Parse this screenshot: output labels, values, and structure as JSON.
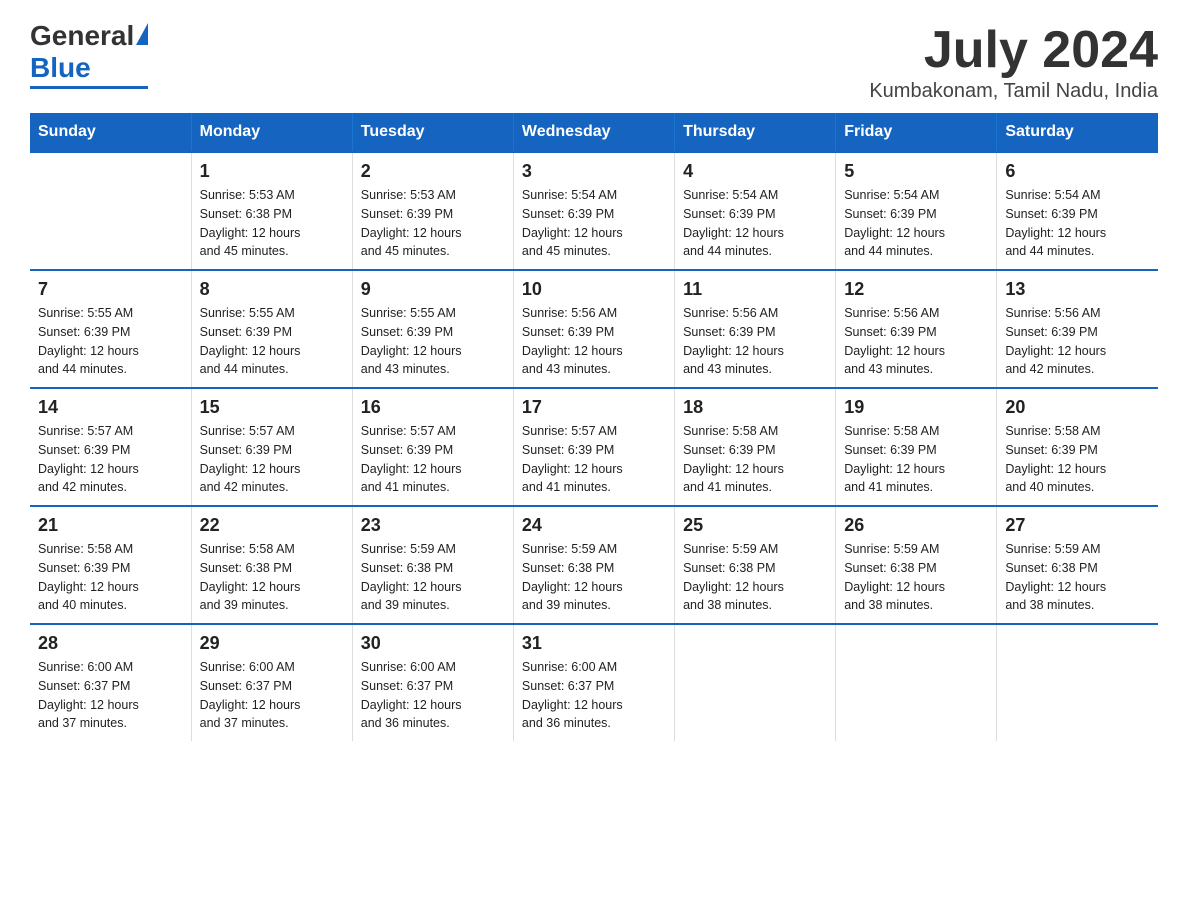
{
  "logo": {
    "general": "General",
    "blue": "Blue"
  },
  "title": "July 2024",
  "subtitle": "Kumbakonam, Tamil Nadu, India",
  "days_header": [
    "Sunday",
    "Monday",
    "Tuesday",
    "Wednesday",
    "Thursday",
    "Friday",
    "Saturday"
  ],
  "weeks": [
    [
      {
        "day": "",
        "info": ""
      },
      {
        "day": "1",
        "info": "Sunrise: 5:53 AM\nSunset: 6:38 PM\nDaylight: 12 hours\nand 45 minutes."
      },
      {
        "day": "2",
        "info": "Sunrise: 5:53 AM\nSunset: 6:39 PM\nDaylight: 12 hours\nand 45 minutes."
      },
      {
        "day": "3",
        "info": "Sunrise: 5:54 AM\nSunset: 6:39 PM\nDaylight: 12 hours\nand 45 minutes."
      },
      {
        "day": "4",
        "info": "Sunrise: 5:54 AM\nSunset: 6:39 PM\nDaylight: 12 hours\nand 44 minutes."
      },
      {
        "day": "5",
        "info": "Sunrise: 5:54 AM\nSunset: 6:39 PM\nDaylight: 12 hours\nand 44 minutes."
      },
      {
        "day": "6",
        "info": "Sunrise: 5:54 AM\nSunset: 6:39 PM\nDaylight: 12 hours\nand 44 minutes."
      }
    ],
    [
      {
        "day": "7",
        "info": "Sunrise: 5:55 AM\nSunset: 6:39 PM\nDaylight: 12 hours\nand 44 minutes."
      },
      {
        "day": "8",
        "info": "Sunrise: 5:55 AM\nSunset: 6:39 PM\nDaylight: 12 hours\nand 44 minutes."
      },
      {
        "day": "9",
        "info": "Sunrise: 5:55 AM\nSunset: 6:39 PM\nDaylight: 12 hours\nand 43 minutes."
      },
      {
        "day": "10",
        "info": "Sunrise: 5:56 AM\nSunset: 6:39 PM\nDaylight: 12 hours\nand 43 minutes."
      },
      {
        "day": "11",
        "info": "Sunrise: 5:56 AM\nSunset: 6:39 PM\nDaylight: 12 hours\nand 43 minutes."
      },
      {
        "day": "12",
        "info": "Sunrise: 5:56 AM\nSunset: 6:39 PM\nDaylight: 12 hours\nand 43 minutes."
      },
      {
        "day": "13",
        "info": "Sunrise: 5:56 AM\nSunset: 6:39 PM\nDaylight: 12 hours\nand 42 minutes."
      }
    ],
    [
      {
        "day": "14",
        "info": "Sunrise: 5:57 AM\nSunset: 6:39 PM\nDaylight: 12 hours\nand 42 minutes."
      },
      {
        "day": "15",
        "info": "Sunrise: 5:57 AM\nSunset: 6:39 PM\nDaylight: 12 hours\nand 42 minutes."
      },
      {
        "day": "16",
        "info": "Sunrise: 5:57 AM\nSunset: 6:39 PM\nDaylight: 12 hours\nand 41 minutes."
      },
      {
        "day": "17",
        "info": "Sunrise: 5:57 AM\nSunset: 6:39 PM\nDaylight: 12 hours\nand 41 minutes."
      },
      {
        "day": "18",
        "info": "Sunrise: 5:58 AM\nSunset: 6:39 PM\nDaylight: 12 hours\nand 41 minutes."
      },
      {
        "day": "19",
        "info": "Sunrise: 5:58 AM\nSunset: 6:39 PM\nDaylight: 12 hours\nand 41 minutes."
      },
      {
        "day": "20",
        "info": "Sunrise: 5:58 AM\nSunset: 6:39 PM\nDaylight: 12 hours\nand 40 minutes."
      }
    ],
    [
      {
        "day": "21",
        "info": "Sunrise: 5:58 AM\nSunset: 6:39 PM\nDaylight: 12 hours\nand 40 minutes."
      },
      {
        "day": "22",
        "info": "Sunrise: 5:58 AM\nSunset: 6:38 PM\nDaylight: 12 hours\nand 39 minutes."
      },
      {
        "day": "23",
        "info": "Sunrise: 5:59 AM\nSunset: 6:38 PM\nDaylight: 12 hours\nand 39 minutes."
      },
      {
        "day": "24",
        "info": "Sunrise: 5:59 AM\nSunset: 6:38 PM\nDaylight: 12 hours\nand 39 minutes."
      },
      {
        "day": "25",
        "info": "Sunrise: 5:59 AM\nSunset: 6:38 PM\nDaylight: 12 hours\nand 38 minutes."
      },
      {
        "day": "26",
        "info": "Sunrise: 5:59 AM\nSunset: 6:38 PM\nDaylight: 12 hours\nand 38 minutes."
      },
      {
        "day": "27",
        "info": "Sunrise: 5:59 AM\nSunset: 6:38 PM\nDaylight: 12 hours\nand 38 minutes."
      }
    ],
    [
      {
        "day": "28",
        "info": "Sunrise: 6:00 AM\nSunset: 6:37 PM\nDaylight: 12 hours\nand 37 minutes."
      },
      {
        "day": "29",
        "info": "Sunrise: 6:00 AM\nSunset: 6:37 PM\nDaylight: 12 hours\nand 37 minutes."
      },
      {
        "day": "30",
        "info": "Sunrise: 6:00 AM\nSunset: 6:37 PM\nDaylight: 12 hours\nand 36 minutes."
      },
      {
        "day": "31",
        "info": "Sunrise: 6:00 AM\nSunset: 6:37 PM\nDaylight: 12 hours\nand 36 minutes."
      },
      {
        "day": "",
        "info": ""
      },
      {
        "day": "",
        "info": ""
      },
      {
        "day": "",
        "info": ""
      }
    ]
  ]
}
